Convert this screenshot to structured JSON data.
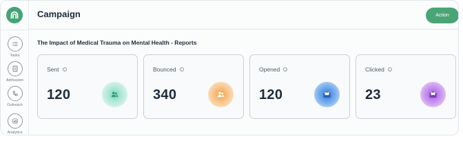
{
  "sidebar": {
    "items": [
      {
        "label": "Tasks",
        "icon": "list-icon"
      },
      {
        "label": "Admission",
        "icon": "document-icon"
      },
      {
        "label": "Outreach",
        "icon": "phone-icon"
      },
      {
        "label": "Analytics",
        "icon": "chart-icon"
      }
    ]
  },
  "header": {
    "title": "Campaign",
    "action_label": "Action",
    "accent": "#4aa476"
  },
  "report": {
    "title": "The Impact of Medical Trauma on Mental Health - Reports"
  },
  "stats": [
    {
      "label": "Sent",
      "value": "120",
      "icon": "users-icon",
      "color": "#8fd9c2"
    },
    {
      "label": "Bounced",
      "value": "340",
      "icon": "users-icon",
      "color": "#f5b26b"
    },
    {
      "label": "Opened",
      "value": "120",
      "icon": "envelope-icon",
      "color": "#4b8fe0"
    },
    {
      "label": "Clicked",
      "value": "23",
      "icon": "envelope-icon",
      "color": "#b06be0"
    }
  ]
}
